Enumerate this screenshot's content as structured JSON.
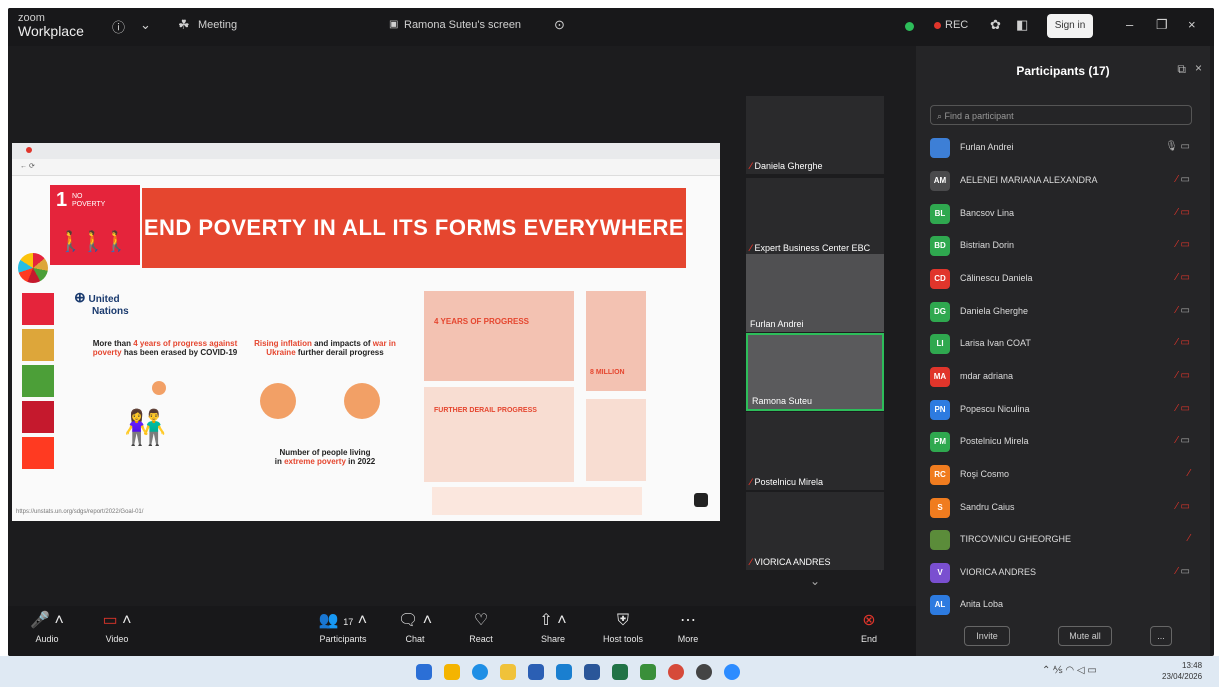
{
  "titlebar": {
    "brand_small": "zoom",
    "brand": "Workplace",
    "meeting_label": "Meeting",
    "screen_label": "Ramona Suteu's screen",
    "rec_label": "REC",
    "sign_in": "Sign in"
  },
  "slide": {
    "goal_number": "1",
    "goal_word": "NO POVERTY",
    "banner": "END POVERTY IN ALL ITS FORMS EVERYWHERE",
    "un_line1": "United",
    "un_line2": "Nations",
    "col1_a": "More than ",
    "col1_b": "4 years of progress against poverty",
    "col1_c": " has been erased by COVID-19",
    "col2_a": "Rising inflation",
    "col2_b": " and impacts of ",
    "col2_c": "war in Ukraine",
    "col2_d": " further derail progress",
    "col2_bottom_a": "Number of people living",
    "col2_bottom_b": "in ",
    "col2_bottom_c": "extreme poverty",
    "col2_bottom_d": " in 2022",
    "infographic_1": "4 YEARS OF PROGRESS",
    "infographic_2": "FURTHER DERAIL PROGRESS",
    "infographic_3": "8 MILLION",
    "footer_url": "https://unstats.un.org/sdgs/report/2022/Goal-01/"
  },
  "videos": [
    {
      "name": "Daniela Gherghe",
      "muted": true
    },
    {
      "name": "Expert Business Center EBC",
      "muted": true
    },
    {
      "name": "Furlan Andrei",
      "muted": false
    },
    {
      "name": "Ramona Suteu",
      "muted": false
    },
    {
      "name": "Postelnicu Mirela",
      "muted": true
    },
    {
      "name": "VIORICA ANDRES",
      "muted": true
    }
  ],
  "panel": {
    "title": "Participants (17)",
    "search_placeholder": "Find a participant",
    "invite": "Invite",
    "mute_all": "Mute all",
    "more": "...",
    "participants": [
      {
        "initials": "",
        "name": "Furlan Andrei",
        "color": "#3d7fd6"
      },
      {
        "initials": "AM",
        "name": "AELENEI MARIANA ALEXANDRA",
        "color": "#4a4a4c"
      },
      {
        "initials": "BL",
        "name": "Bancsov Lina",
        "color": "#2fa84f"
      },
      {
        "initials": "BD",
        "name": "Bistrian Dorin",
        "color": "#2fa84f"
      },
      {
        "initials": "CD",
        "name": "Călinescu Daniela",
        "color": "#e0352b"
      },
      {
        "initials": "DG",
        "name": "Daniela Gherghe",
        "color": "#2fa84f"
      },
      {
        "initials": "LI",
        "name": "Larisa Ivan COAT",
        "color": "#2fa84f"
      },
      {
        "initials": "MA",
        "name": "mdar adriana",
        "color": "#e0352b"
      },
      {
        "initials": "PN",
        "name": "Popescu Niculina",
        "color": "#2d7be0"
      },
      {
        "initials": "PM",
        "name": "Postelnicu Mirela",
        "color": "#2fa84f"
      },
      {
        "initials": "RC",
        "name": "Roşi Cosmo",
        "color": "#f07c1f"
      },
      {
        "initials": "S",
        "name": "Sandru Caius",
        "color": "#f07c1f"
      },
      {
        "initials": "",
        "name": "TIRCOVNICU GHEORGHE",
        "color": "#5b8c3a"
      },
      {
        "initials": "V",
        "name": "VIORICA ANDRES",
        "color": "#7a4fd0"
      },
      {
        "initials": "AL",
        "name": "Anita Loba",
        "color": "#2d7be0"
      }
    ]
  },
  "toolbar": {
    "audio": "Audio",
    "video": "Video",
    "participants": "Participants",
    "participants_count": "17",
    "chat": "Chat",
    "react": "React",
    "share": "Share",
    "host_tools": "Host tools",
    "more": "More",
    "end": "End"
  },
  "taskbar": {
    "time": "13:48",
    "date": "23/04/2026"
  }
}
